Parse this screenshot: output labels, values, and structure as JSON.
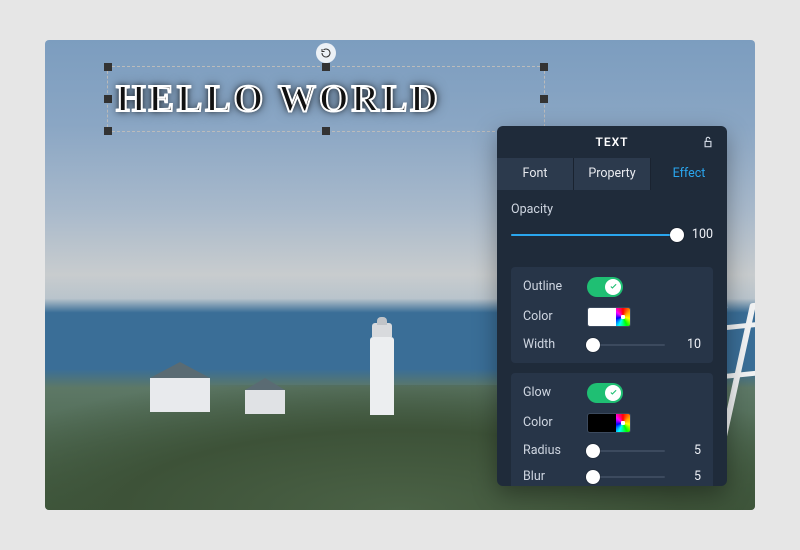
{
  "canvas": {
    "text_content": "HELLO WORLD"
  },
  "panel": {
    "title": "TEXT",
    "tabs": {
      "font": {
        "label": "Font",
        "active": false
      },
      "property": {
        "label": "Property",
        "active": false
      },
      "effect": {
        "label": "Effect",
        "active": true
      }
    },
    "opacity": {
      "label": "Opacity",
      "value": "100",
      "fill_pct": "100%",
      "thumb_pct": "100%"
    },
    "outline": {
      "label": "Outline",
      "enabled": true,
      "color_label": "Color",
      "color_hex": "#ffffff",
      "width_label": "Width",
      "width_value": "10",
      "width_thumb_pct": "8%"
    },
    "glow": {
      "label": "Glow",
      "enabled": true,
      "color_label": "Color",
      "color_hex": "#000000",
      "radius_label": "Radius",
      "radius_value": "5",
      "radius_thumb_pct": "8%",
      "blur_label": "Blur",
      "blur_value": "5",
      "blur_thumb_pct": "8%"
    }
  }
}
